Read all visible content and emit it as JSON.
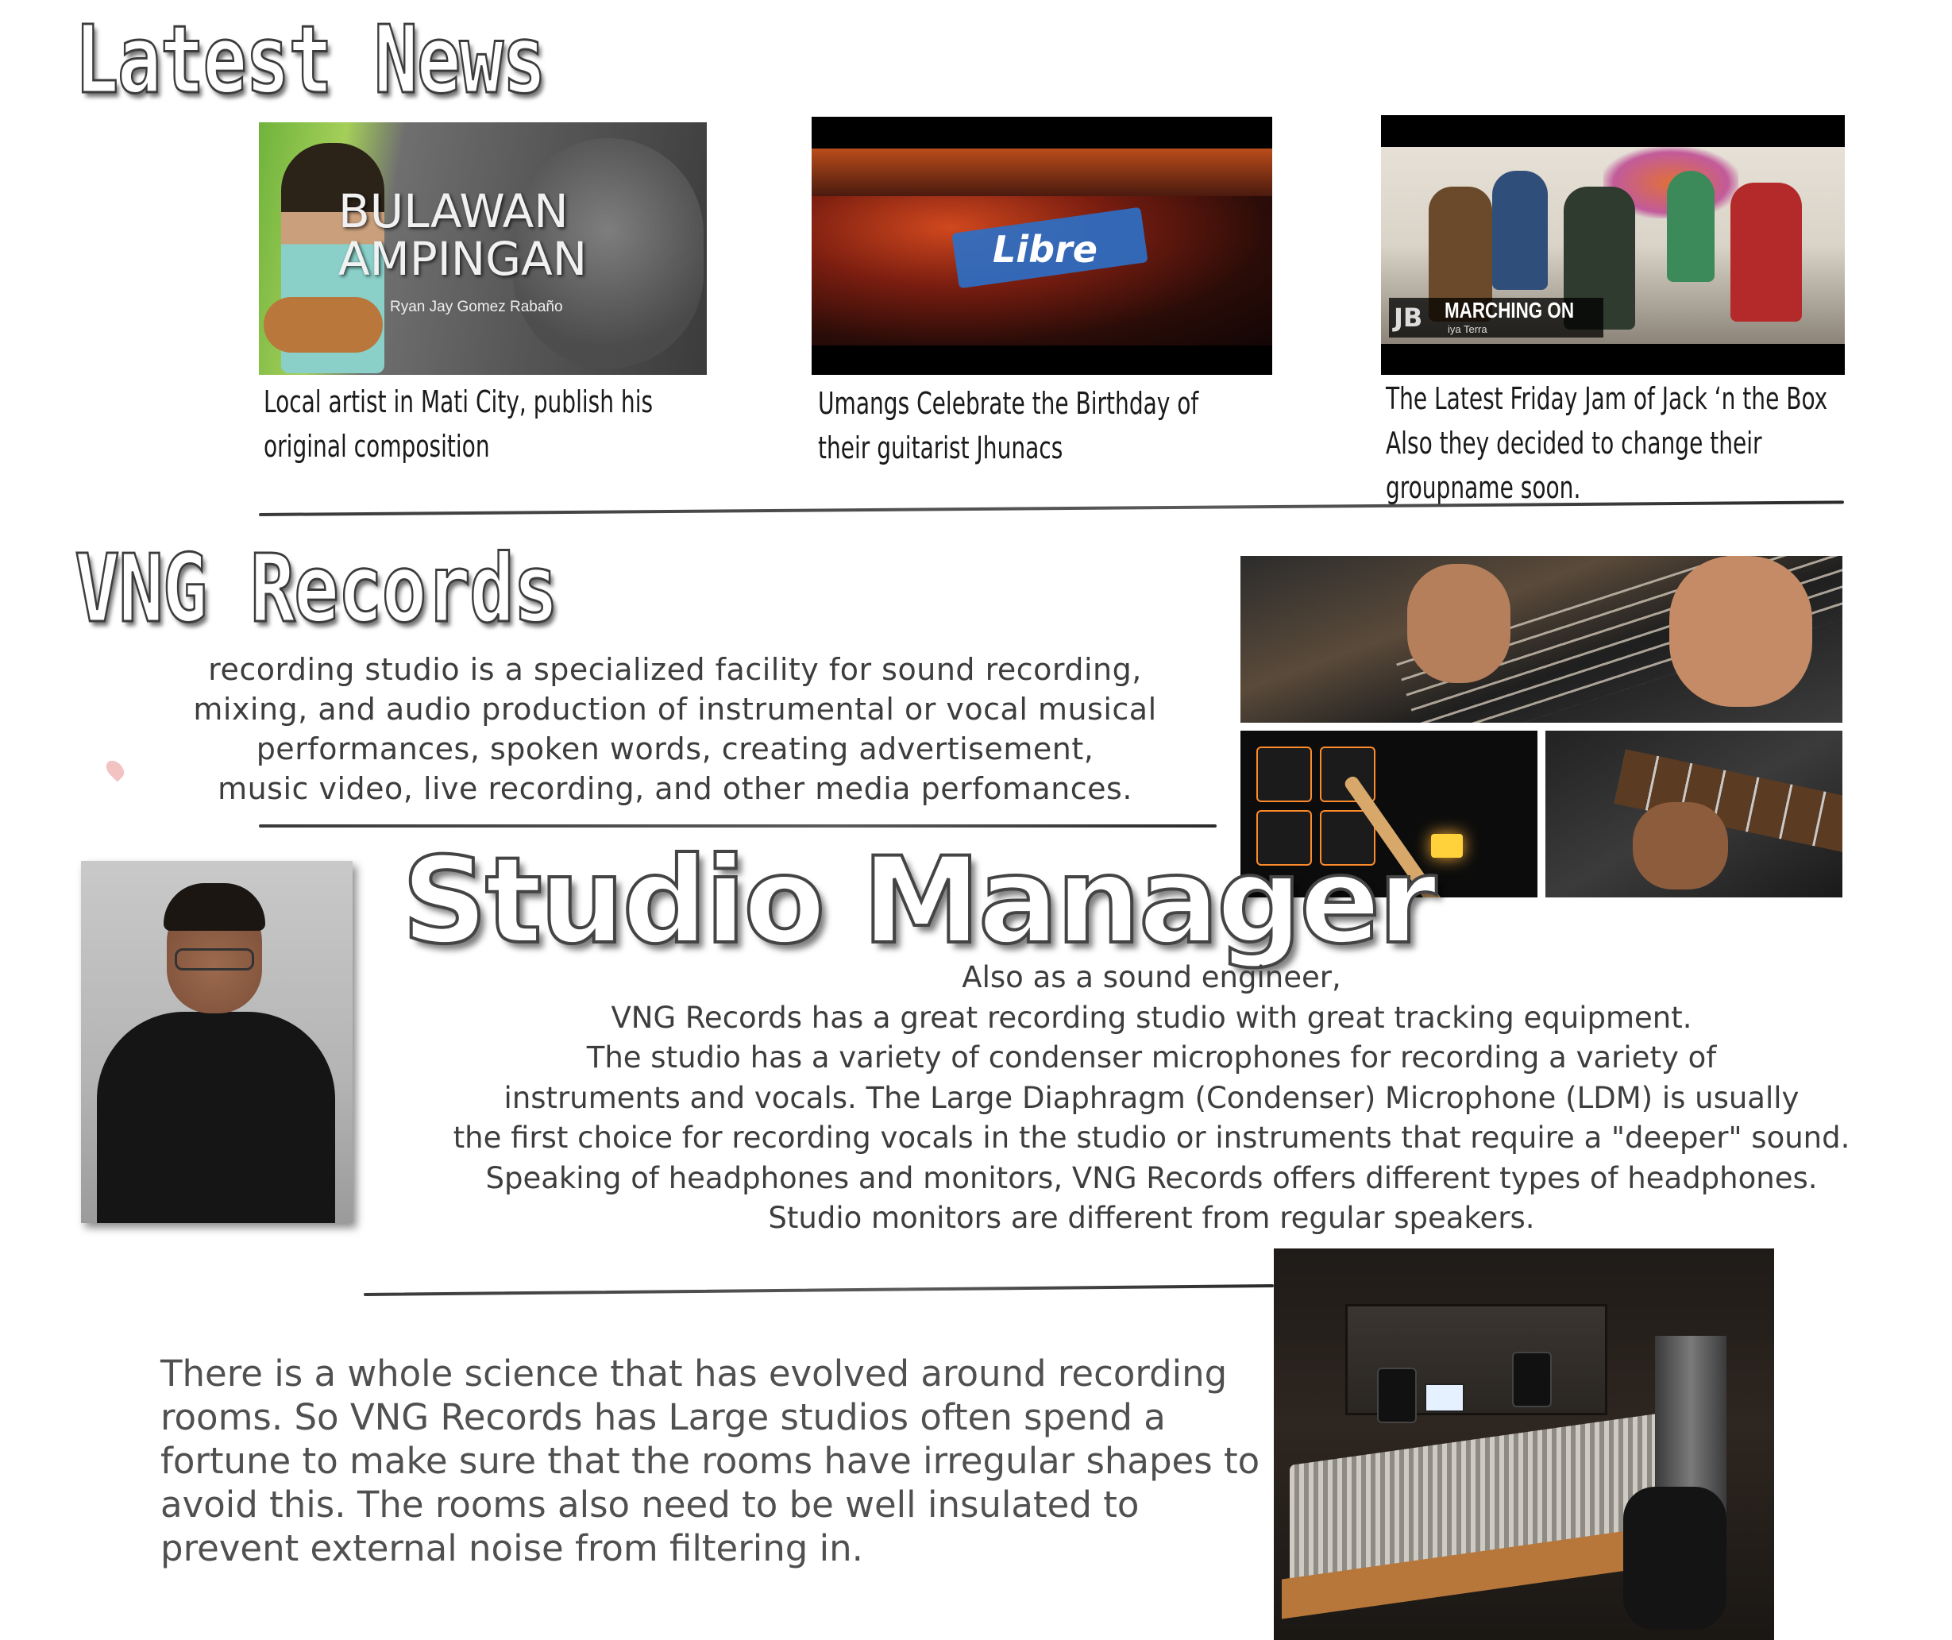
{
  "latest_news": {
    "heading": "Latest News",
    "items": [
      {
        "thumbnail": {
          "title_line1": "BULAWAN",
          "title_line2": "AMPINGAN",
          "subtitle": "Ryan Jay Gomez Rabaño"
        },
        "caption_lines": [
          "Local artist in Mati City, publish his",
          "original composition"
        ]
      },
      {
        "thumbnail": {
          "label": "Libre"
        },
        "caption_lines": [
          "Umangs Celebrate the Birthday of",
          "their guitarist Jhunacs"
        ]
      },
      {
        "thumbnail": {
          "title": "MARCHING ON",
          "subtitle": "iya Terra",
          "logo": "JB"
        },
        "caption_lines": [
          "The Latest Friday Jam of Jack ‘n the Box",
          "Also they decided to change their",
          "groupname soon."
        ]
      }
    ]
  },
  "vng_records": {
    "heading": "VNG Records",
    "description_lines": [
      "recording studio is a specialized facility for sound recording,",
      "mixing, and audio production of instrumental or vocal musical",
      "performances, spoken words, creating advertisement,",
      "music video, live recording, and other media perfomances."
    ]
  },
  "studio_manager": {
    "heading": "Studio Manager",
    "description_lines": [
      "Also as a sound engineer,",
      "VNG Records has a great recording studio with great tracking equipment.",
      "The  studio has a variety of  condenser microphones for recording a variety of",
      "instruments and vocals.  The  Large Diaphragm (Condenser) Microphone (LDM) is usually",
      "the first choice for recording vocals in the studio or instruments that require a \"deeper\" sound.",
      "Speaking of  headphones and monitors,  VNG Records offers different types of headphones.",
      "Studio monitors are different from  regular speakers."
    ]
  },
  "rooms": {
    "description_lines": [
      "There is a whole science that has evolved around recording",
      "rooms. So VNG Records has Large studios often spend a",
      "fortune to make sure that the rooms have irregular shapes to",
      "avoid this. The rooms also need to be well insulated to",
      "prevent external noise from filtering in."
    ]
  },
  "colors": {
    "heading_outline": "#3c3c3c",
    "body_text": "#3d3d3d",
    "caption_text": "#1a1a1a",
    "libre_brush": "#2e6fc4"
  },
  "icons": {
    "pin": "map-pin-icon"
  }
}
